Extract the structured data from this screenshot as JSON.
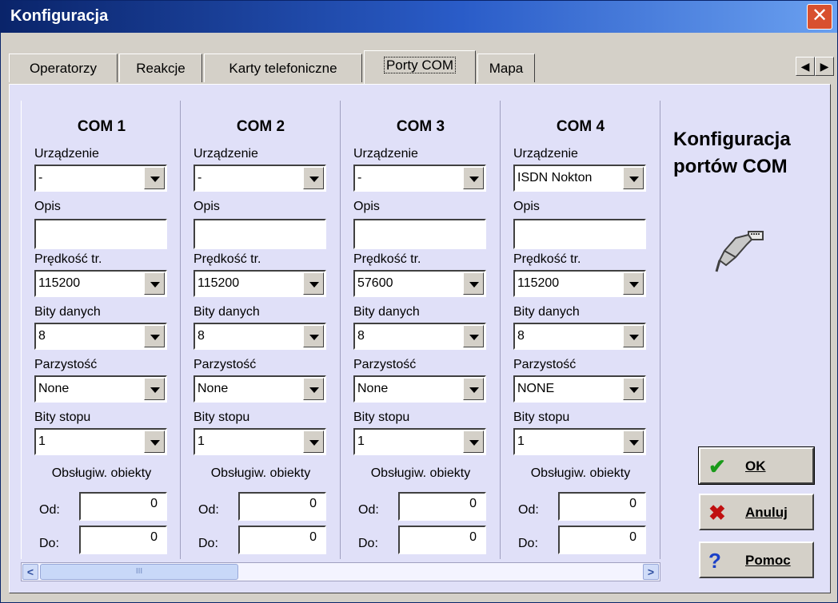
{
  "window": {
    "title": "Konfiguracja",
    "close_glyph": "✕"
  },
  "tabs": [
    {
      "label": "Operatorzy",
      "active": false
    },
    {
      "label": "Reakcje",
      "active": false
    },
    {
      "label": "Karty telefoniczne",
      "active": false
    },
    {
      "label": "Porty COM",
      "active": true
    },
    {
      "label": "Mapa",
      "active": false
    }
  ],
  "tab_scroll": {
    "left": "◀",
    "right": "▶"
  },
  "labels": {
    "device": "Urządzenie",
    "description": "Opis",
    "speed": "Prędkość tr.",
    "data_bits": "Bity danych",
    "parity": "Parzystość",
    "stop_bits": "Bity stopu",
    "objects": "Obsługiw. obiekty",
    "from": "Od:",
    "to": "Do:"
  },
  "ports": [
    {
      "title": "COM  1",
      "device": "-",
      "description": "",
      "speed": "115200",
      "data_bits": "8",
      "parity": "None",
      "stop_bits": "1",
      "from": "0",
      "to": "0"
    },
    {
      "title": "COM  2",
      "device": "-",
      "description": "",
      "speed": "115200",
      "data_bits": "8",
      "parity": "None",
      "stop_bits": "1",
      "from": "0",
      "to": "0"
    },
    {
      "title": "COM  3",
      "device": "-",
      "description": "",
      "speed": "57600",
      "data_bits": "8",
      "parity": "None",
      "stop_bits": "1",
      "from": "0",
      "to": "0"
    },
    {
      "title": "COM  4",
      "device": "ISDN Nokton",
      "description": "",
      "speed": "115200",
      "data_bits": "8",
      "parity": "NONE",
      "stop_bits": "1",
      "from": "0",
      "to": "0"
    }
  ],
  "scrollbar": {
    "left": "<",
    "right": ">",
    "thumb_grip": "III"
  },
  "side": {
    "title_line1": "Konfiguracja",
    "title_line2": "portów COM"
  },
  "buttons": {
    "ok": {
      "label": "OK",
      "icon": "check-icon",
      "icon_glyph": "✔",
      "icon_color": "#1a9a1a"
    },
    "cancel": {
      "label": "Anuluj",
      "icon": "x-icon",
      "icon_glyph": "✖",
      "icon_color": "#c01010"
    },
    "help": {
      "label": "Pomoc",
      "icon": "question-icon",
      "icon_glyph": "?",
      "icon_color": "#1a40c8"
    }
  }
}
